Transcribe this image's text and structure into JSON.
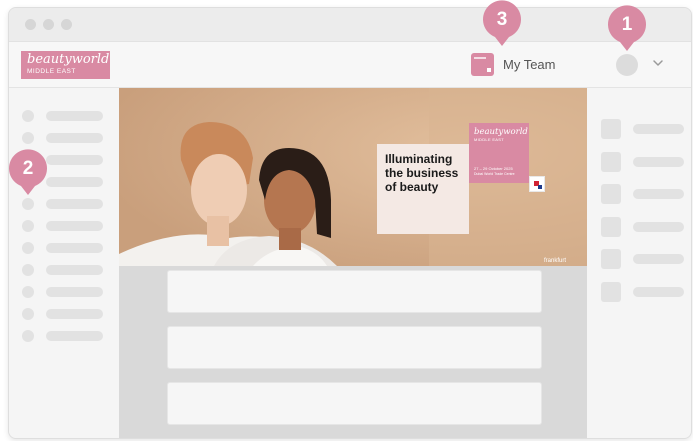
{
  "window": {
    "traffic_lights": [
      "close",
      "minimize",
      "maximize"
    ]
  },
  "header": {
    "logo": {
      "main": "beautyworld",
      "sub": "MIDDLE EAST"
    },
    "team": {
      "label": "My Team",
      "icon": "team-logo-icon"
    },
    "avatar": {
      "icon": "user-avatar-icon"
    },
    "dropdown": {
      "icon": "chevron-down-icon"
    }
  },
  "banner": {
    "headline": [
      "Illuminating",
      "the business",
      "of beauty"
    ],
    "brand_main": "beautyworld",
    "brand_sub": "MIDDLE EAST",
    "dates": "27 – 29 October 2025",
    "venue": "Dubai World Trade Centre",
    "footer": "frankfurt"
  },
  "markers": [
    {
      "number": "1",
      "target": "avatar"
    },
    {
      "number": "2",
      "target": "sidebar"
    },
    {
      "number": "3",
      "target": "my-team"
    }
  ],
  "colors": {
    "accent": "#d98aa3",
    "banner_bg": "#d7b08d",
    "skeleton": "#e2e2e2",
    "window_bg": "#ededed"
  }
}
